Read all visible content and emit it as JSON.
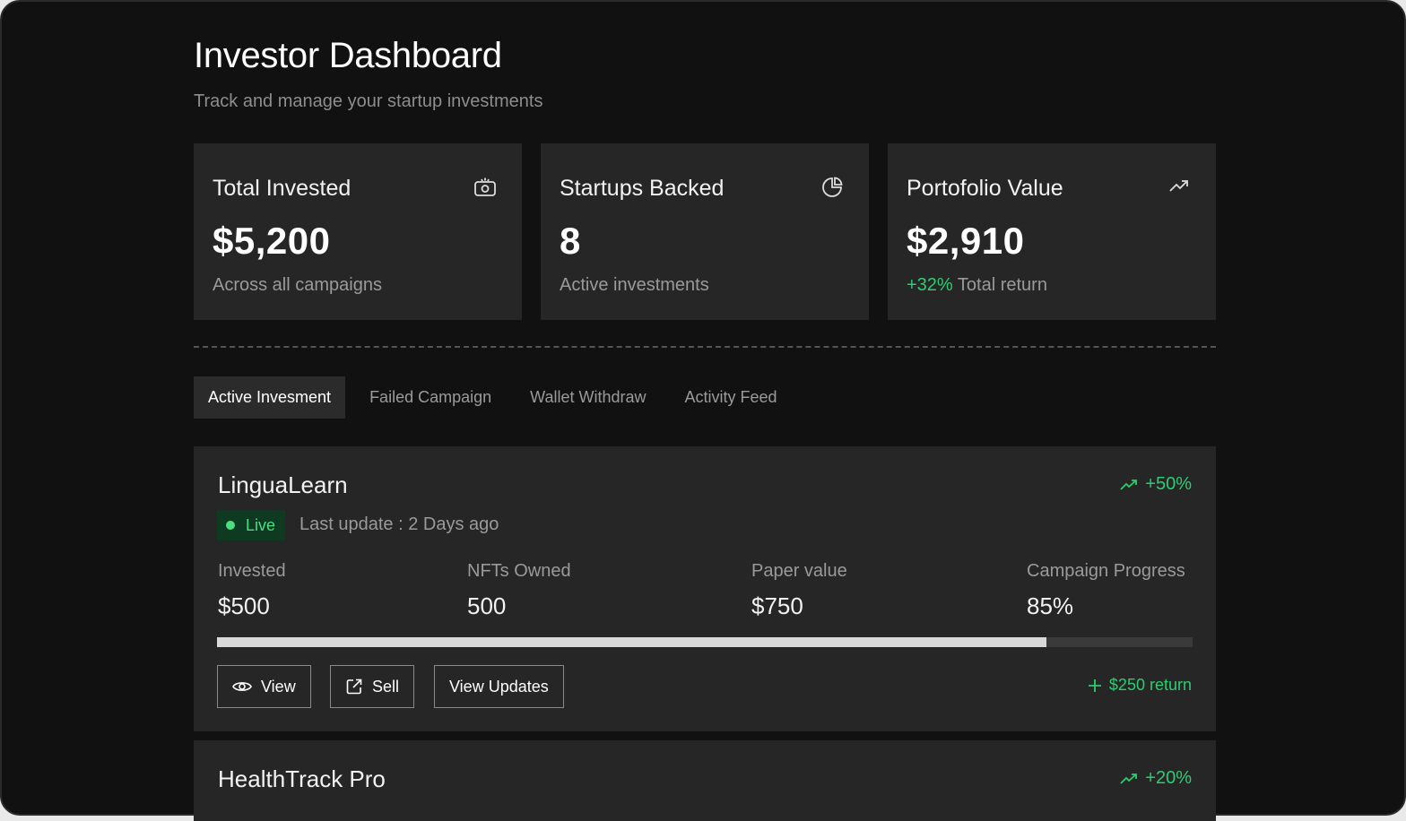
{
  "header": {
    "title": "Investor Dashboard",
    "subtitle": "Track and manage your startup investments"
  },
  "stats": [
    {
      "label": "Total Invested",
      "value": "$5,200",
      "desc": "Across all campaigns",
      "icon": "money-icon"
    },
    {
      "label": "Startups Backed",
      "value": "8",
      "desc": "Active investments",
      "icon": "pie-chart-icon"
    },
    {
      "label": "Portofolio Value",
      "value": "$2,910",
      "desc_positive": "+32%",
      "desc": " Total return",
      "icon": "trending-up-icon"
    }
  ],
  "tabs": [
    {
      "label": "Active Invesment",
      "active": true
    },
    {
      "label": "Failed Campaign",
      "active": false
    },
    {
      "label": "Wallet Withdraw",
      "active": false
    },
    {
      "label": "Activity Feed",
      "active": false
    }
  ],
  "investments": [
    {
      "name": "LinguaLearn",
      "change": "+50%",
      "status": "Live",
      "last_update": "Last update : 2 Days ago",
      "metrics": [
        {
          "label": "Invested",
          "value": "$500"
        },
        {
          "label": "NFTs Owned",
          "value": "500"
        },
        {
          "label": "Paper value",
          "value": "$750"
        },
        {
          "label": "Campaign Progress",
          "value": "85%"
        }
      ],
      "progress": 0.85,
      "buttons": {
        "view": "View",
        "sell": "Sell",
        "updates": "View Updates"
      },
      "returns": "$250 return"
    },
    {
      "name": "HealthTrack Pro",
      "change": "+20%"
    }
  ],
  "colors": {
    "accent_green": "#2ecc71",
    "card_bg": "#262626",
    "page_bg": "#111111"
  }
}
